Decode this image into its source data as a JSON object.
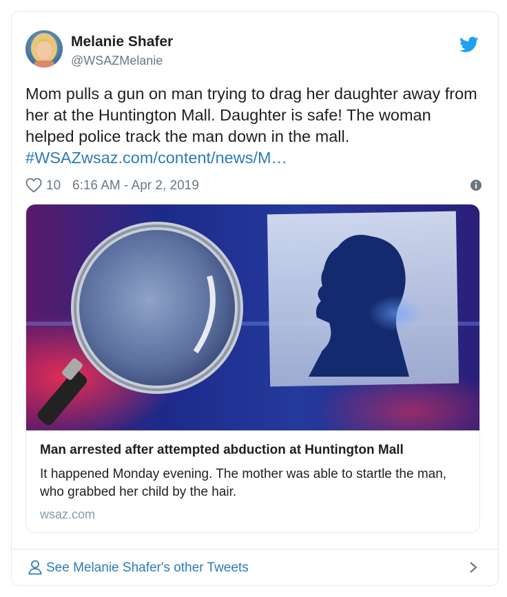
{
  "tweet": {
    "author": {
      "name": "Melanie Shafer",
      "handle": "@WSAZMelanie"
    },
    "icons": {
      "brand": "twitter-bird-icon",
      "like": "heart-icon",
      "info": "info-icon",
      "profile": "person-icon",
      "more": "chevron-right-icon"
    },
    "text_lines": [
      "Mom pulls a gun on man trying to drag her daughter away from",
      "her at the Huntington Mall.    Daughter is safe!  The woman",
      "helped police track the man down in the mall."
    ],
    "hashtag": "#WSAZ",
    "link": "wsaz.com/content/news/M…",
    "likes": "10",
    "timestamp": "6:16 AM - Apr 2, 2019",
    "card": {
      "title": "Man arrested after attempted abduction at Huntington Mall",
      "description": "It happened Monday evening. The mother was able to startle the man, who grabbed her child by the hair.",
      "domain": "wsaz.com"
    },
    "footer_label": "See Melanie Shafer's other Tweets"
  },
  "colors": {
    "link": "#2b7bb9",
    "text": "#1c2022",
    "muted": "#697882",
    "border": "#e1e8ed",
    "twitter_blue": "#1da1f2"
  }
}
